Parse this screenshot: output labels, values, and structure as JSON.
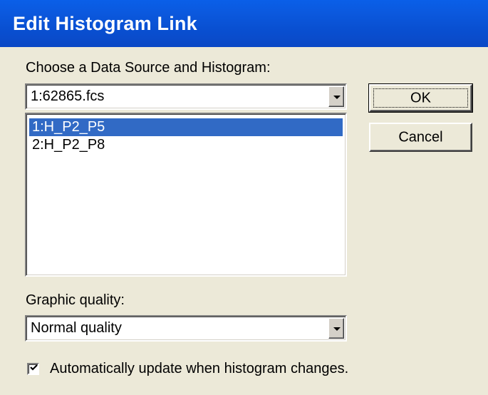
{
  "window": {
    "title": "Edit Histogram Link"
  },
  "source_section": {
    "label": "Choose a Data Source and Histogram:",
    "selected_source": "1:62865.fcs",
    "histograms": [
      "1:H_P2_P5",
      "2:H_P2_P8"
    ],
    "selected_index": 0
  },
  "buttons": {
    "ok_label": "OK",
    "cancel_label": "Cancel"
  },
  "quality_section": {
    "label": "Graphic quality:",
    "selected_quality": "Normal quality"
  },
  "auto_update": {
    "label": "Automatically update when histogram changes.",
    "checked": true
  },
  "colors": {
    "titlebar": "#0a54d8",
    "selection": "#316ac5",
    "dialog_background": "#ece9d8"
  }
}
